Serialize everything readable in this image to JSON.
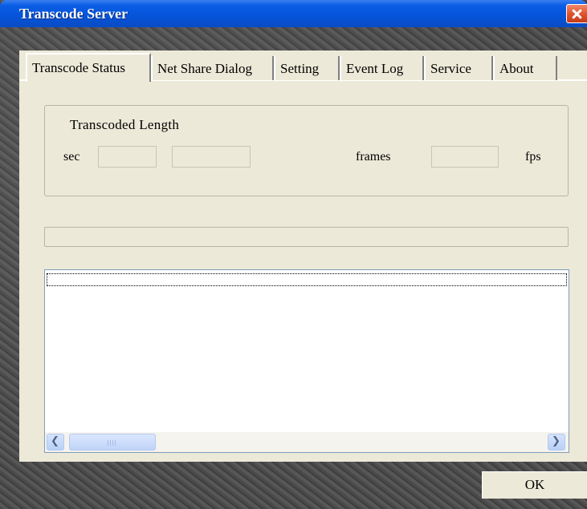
{
  "window": {
    "title": "Transcode Server"
  },
  "tabs": [
    {
      "label": "Transcode Status",
      "active": true
    },
    {
      "label": "Net Share Dialog",
      "active": false
    },
    {
      "label": "Setting",
      "active": false
    },
    {
      "label": "Event Log",
      "active": false
    },
    {
      "label": "Service",
      "active": false
    },
    {
      "label": "About",
      "active": false
    }
  ],
  "transcoded": {
    "group_label": "Transcoded Length",
    "sec_label": "sec",
    "sec_value": "",
    "sec_value2": "",
    "frames_label": "frames",
    "frames_value": "",
    "fps_label": "fps"
  },
  "progress": {
    "value": 0
  },
  "list": {
    "items": []
  },
  "scrollbar": {
    "left_icon": "scroll-left-arrow-icon",
    "right_icon": "scroll-right-arrow-icon"
  },
  "buttons": {
    "ok_label": "OK"
  },
  "colors": {
    "titlebar": "#0553d8",
    "dialog_bg": "#ece9d8",
    "close": "#e0552e"
  }
}
